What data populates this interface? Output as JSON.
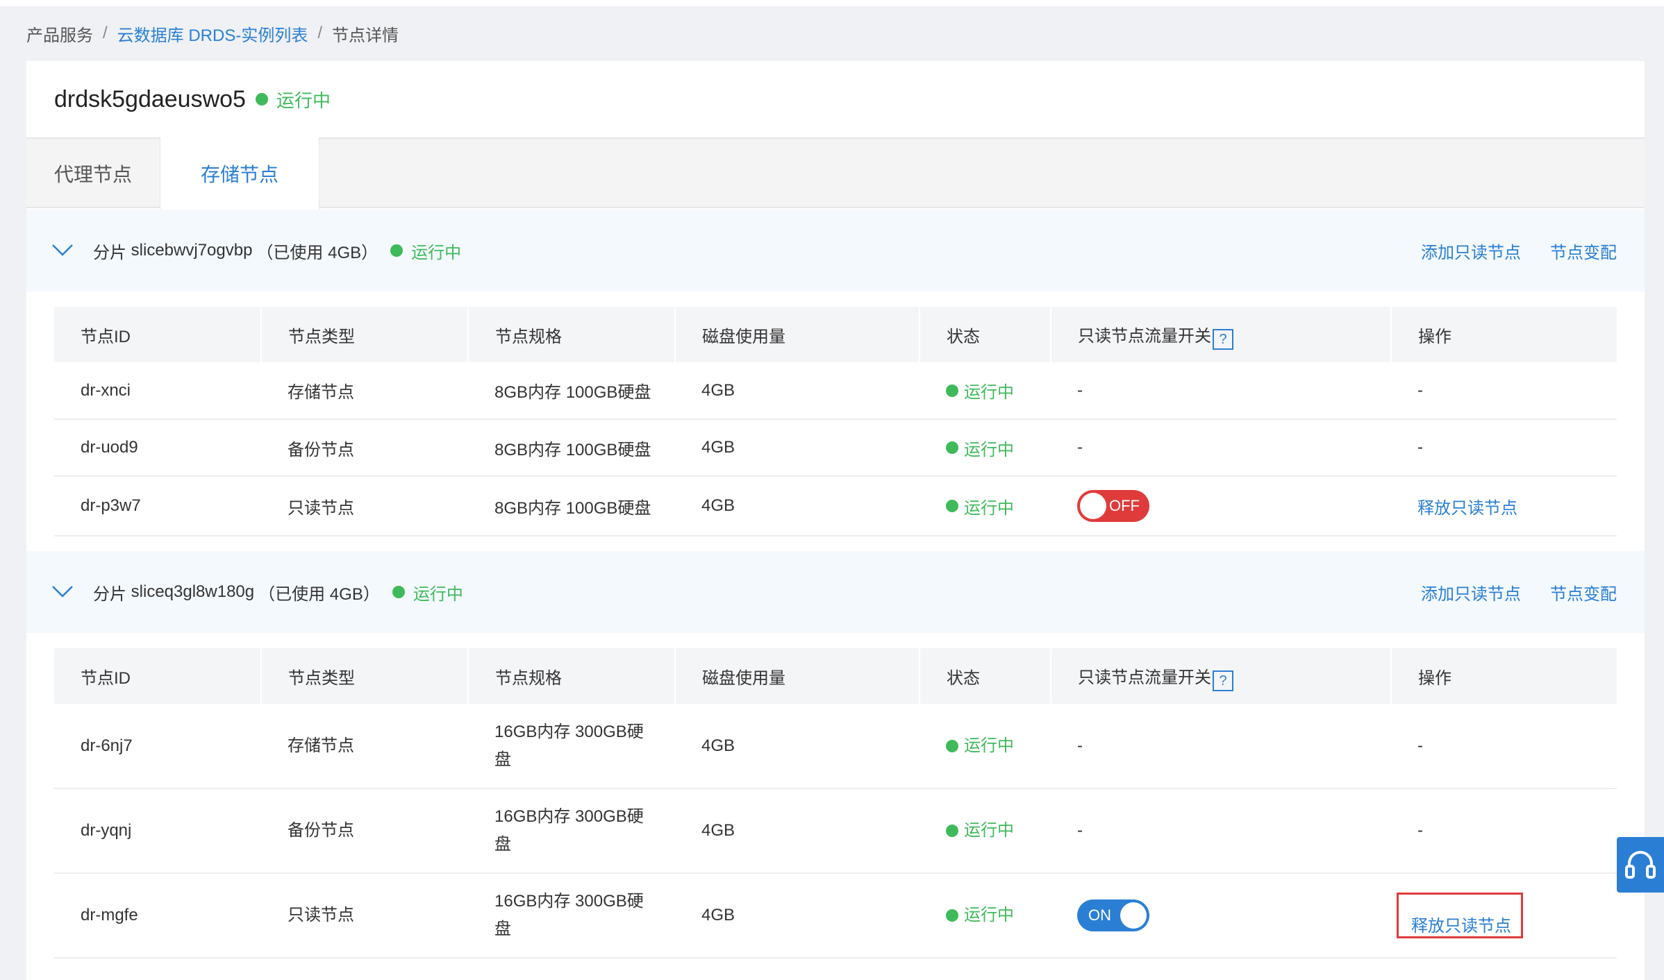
{
  "breadcrumb": {
    "item1": "产品服务",
    "separator": "/",
    "item2": "云数据库 DRDS-实例列表",
    "item3": "节点详情"
  },
  "instance": {
    "name": "drdsk5gdaeuswo5",
    "status": "运行中"
  },
  "tabs": {
    "proxy": "代理节点",
    "storage": "存储节点",
    "active": "storage"
  },
  "columns": {
    "id": "节点ID",
    "type": "节点类型",
    "spec": "节点规格",
    "disk": "磁盘使用量",
    "status": "状态",
    "switch": "只读节点流量开关",
    "help": "?",
    "op": "操作"
  },
  "shards": [
    {
      "prefix": "分片",
      "name": "slicebwvj7ogvbp",
      "usage": "（已使用 4GB）",
      "status": "运行中",
      "add_readonly": "添加只读节点",
      "change_spec": "节点变配",
      "rows": [
        {
          "id": "dr-xnci",
          "type": "存储节点",
          "spec": "8GB内存 100GB硬盘",
          "disk": "4GB",
          "status": "运行中",
          "switch": "-",
          "op": "-"
        },
        {
          "id": "dr-uod9",
          "type": "备份节点",
          "spec": "8GB内存 100GB硬盘",
          "disk": "4GB",
          "status": "运行中",
          "switch": "-",
          "op": "-"
        },
        {
          "id": "dr-p3w7",
          "type": "只读节点",
          "spec": "8GB内存 100GB硬盘",
          "disk": "4GB",
          "status": "运行中",
          "switch_label": "OFF",
          "op": "释放只读节点"
        }
      ]
    },
    {
      "prefix": "分片",
      "name": "sliceq3gl8w180g",
      "usage": "（已使用 4GB）",
      "status": "运行中",
      "add_readonly": "添加只读节点",
      "change_spec": "节点变配",
      "rows": [
        {
          "id": "dr-6nj7",
          "type": "存储节点",
          "spec": "16GB内存 300GB硬盘",
          "disk": "4GB",
          "status": "运行中",
          "switch": "-",
          "op": "-"
        },
        {
          "id": "dr-yqnj",
          "type": "备份节点",
          "spec": "16GB内存 300GB硬盘",
          "disk": "4GB",
          "status": "运行中",
          "switch": "-",
          "op": "-"
        },
        {
          "id": "dr-mgfe",
          "type": "只读节点",
          "spec": "16GB内存 300GB硬盘",
          "disk": "4GB",
          "status": "运行中",
          "switch_label": "ON",
          "op": "释放只读节点"
        }
      ]
    }
  ],
  "icons": {
    "chevron": "chevron-down-icon",
    "status_dot": "status-dot-icon",
    "help": "help-icon",
    "support": "headset-icon"
  },
  "colors": {
    "link": "#2a7fd4",
    "running": "#3fba5a",
    "toggle_off": "#e03b3b",
    "toggle_on": "#2a7fd4",
    "highlight": "#e03b3b"
  }
}
